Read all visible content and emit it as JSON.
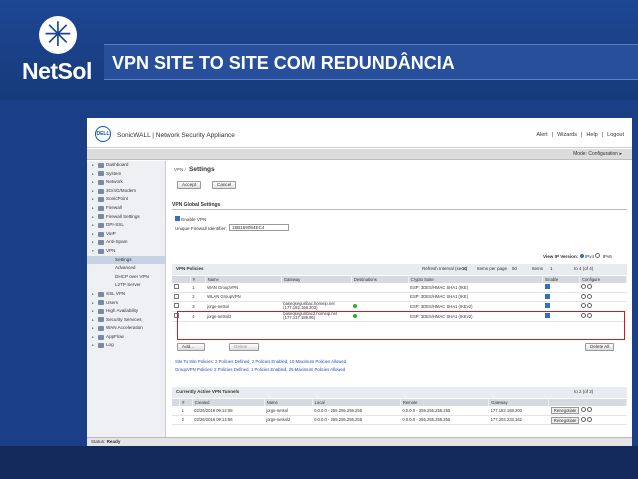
{
  "slide": {
    "title": "VPN SITE TO SITE COM REDUNDÂNCIA",
    "logo_text": "NetSol",
    "logo_icon": "snowflake-icon"
  },
  "app": {
    "logo": "DELL",
    "brand": "SonicWALL | Network Security Appliance",
    "links": [
      "Alert",
      "|",
      "Wizards",
      "|",
      "Help",
      "|",
      "Logout"
    ],
    "mode": "Mode: Configuration ▸"
  },
  "sidebar": {
    "items": [
      {
        "label": "Dashboard"
      },
      {
        "label": "System"
      },
      {
        "label": "Network"
      },
      {
        "label": "3G/4G/Modem"
      },
      {
        "label": "SonicPoint"
      },
      {
        "label": "Firewall"
      },
      {
        "label": "Firewall Settings"
      },
      {
        "label": "DPI-SSL"
      },
      {
        "label": "VoIP"
      },
      {
        "label": "Anti-Spam"
      },
      {
        "label": "VPN"
      }
    ],
    "vpn_sub": [
      {
        "label": "Settings"
      },
      {
        "label": "Advanced"
      },
      {
        "label": "DHCP over VPN"
      },
      {
        "label": "L2TP Server"
      }
    ],
    "items2": [
      {
        "label": "SSL VPN"
      },
      {
        "label": "Users"
      },
      {
        "label": "High Availability"
      },
      {
        "label": "Security Services"
      },
      {
        "label": "WAN Acceleration"
      },
      {
        "label": "AppFlow"
      },
      {
        "label": "Log"
      }
    ]
  },
  "main": {
    "crumb": "VPN /",
    "heading": "Settings",
    "accept": "Accept",
    "cancel": "Cancel",
    "global_title": "VPN Global Settings",
    "enable_vpn": "Enable VPN",
    "fw_id_label": "Unique Firewall Identifier:",
    "fw_id_value": "18B169054EC4",
    "ip_version": "View IP Version:",
    "ipv4": "IPv4",
    "ipv6": "IPv6",
    "policies_title": "VPN Policies",
    "refresh": "Refresh Interval (secs)",
    "refresh_val": "10",
    "items_per_page": "Items per page",
    "ipp_val": "50",
    "items": "Items",
    "items_val": "1",
    "of_text": "to 4 (of 4)",
    "policy_headers": [
      "#",
      "Name",
      "Gateway",
      "Destinations",
      "Crypto Suite",
      "Enable",
      "Configure"
    ],
    "policies": [
      {
        "num": "1",
        "name": "WAN GroupVPN",
        "gateway": "",
        "dest": "",
        "crypto": "ESP: 3DES/HMAC SHA1 (IKE)"
      },
      {
        "num": "2",
        "name": "WLAN GroupVPN",
        "gateway": "",
        "dest": "",
        "crypto": "ESP: 3DES/HMAC SHA1 (IKE)"
      },
      {
        "num": "3",
        "name": "jorge-netsol",
        "gateway": "baseqseguribac.homeip.net (177.182.168.203)",
        "dest": "",
        "crypto": "ESP: 3DES/HMAC SHA1 (IKEv2)"
      },
      {
        "num": "4",
        "name": "jorge-netsol2",
        "gateway": "baseqseguribac2.homeip.net (177.137.189.95)",
        "dest": "",
        "crypto": "ESP: 3DES/HMAC SHA1 (IKEv2)"
      }
    ],
    "add": "Add...",
    "delete": "Delete",
    "delete_all": "Delete All",
    "note1": "Site To Site Policies: 2 Policies Defined, 2 Policies Enabled, 10 Maximum Policies Allowed",
    "note2": "GroupVPN Policies: 2 Policies Defined, 1 Policies Enabled, 25 Maximum Policies Allowed",
    "tunnels_title": "Currently Active VPN Tunnels",
    "tunnels_of": "to 2 (of 2)",
    "tunnel_headers": [
      "#",
      "Created",
      "Name",
      "Local",
      "Remote",
      "Gateway",
      ""
    ],
    "tunnels": [
      {
        "num": "1",
        "created": "02/26/2016 09:12:08",
        "name": "jorge-netsol",
        "local": "0.0.0.0 - 255.255.255.255",
        "remote": "0.0.0.0 - 255.255.255.255",
        "gateway": "177.182.168.203",
        "action": "Renegotiate"
      },
      {
        "num": "2",
        "created": "02/26/2016 09:14:56",
        "name": "jorge-netsol2",
        "local": "0.0.0.0 - 255.255.255.255",
        "remote": "0.0.0.0 - 255.255.255.255",
        "gateway": "177.203.233.162",
        "action": "Renegotiate"
      }
    ],
    "status_label": "Status:",
    "status": "Ready"
  }
}
